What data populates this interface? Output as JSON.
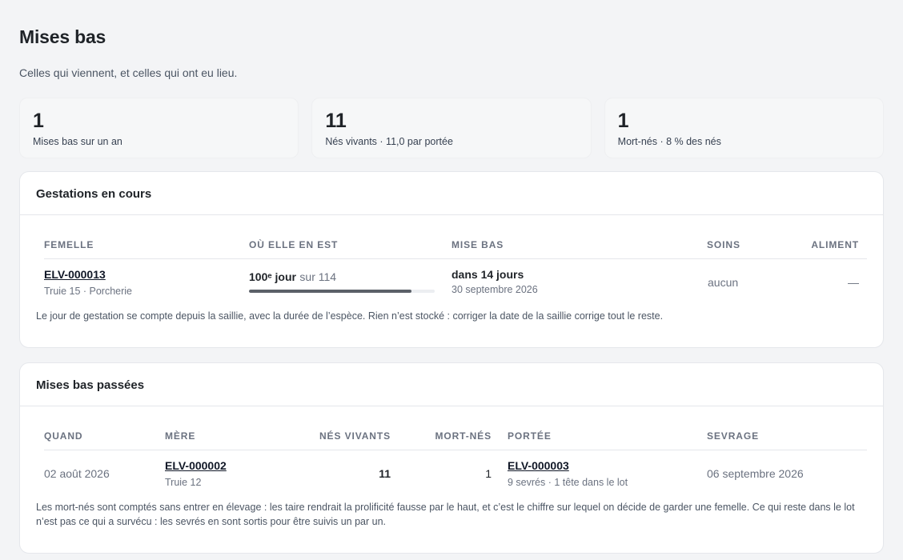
{
  "page": {
    "title": "Mises bas",
    "subtitle": "Celles qui viennent, et celles qui ont eu lieu."
  },
  "stats": [
    {
      "value": "1",
      "label": "Mises bas sur un an"
    },
    {
      "value": "11",
      "label": "Nés vivants · 11,0 par portée"
    },
    {
      "value": "1",
      "label": "Mort-nés · 8 % des nés"
    }
  ],
  "gestations": {
    "title": "Gestations en cours",
    "columns": {
      "femelle": "Femelle",
      "progress": "Où elle en est",
      "mise_bas": "Mise bas",
      "soins": "Soins",
      "aliment": "Aliment"
    },
    "row": {
      "id": "ELV-000013",
      "location": "Truie 15 · Porcherie",
      "day": "100ᵉ jour",
      "of": "sur 114",
      "progress": 0.877,
      "due_in": "dans 14 jours",
      "due_date": "30 septembre 2026",
      "soins": "aucun",
      "aliment": "—"
    },
    "note": "Le jour de gestation se compte depuis la saillie, avec la durée de l’espèce. Rien n’est stocké : corriger la date de la saillie corrige tout le reste."
  },
  "passees": {
    "title": "Mises bas passées",
    "columns": {
      "quand": "Quand",
      "mere": "Mère",
      "vivants": "Nés vivants",
      "mortnes": "Mort-nés",
      "portee": "Portée",
      "sevrage": "Sevrage"
    },
    "row": {
      "date": "02 août 2026",
      "mere_id": "ELV-000002",
      "mere_sub": "Truie 12",
      "vivants": "11",
      "mortnes": "1",
      "portee_id": "ELV-000003",
      "portee_sub": "9 sevrés · 1 tête dans le lot",
      "sevrage": "06 septembre 2026"
    },
    "note": "Les mort-nés sont comptés sans entrer en élevage : les taire rendrait la prolificité fausse par le haut, et c’est le chiffre sur lequel on décide de garder une femelle. Ce qui reste dans le lot n’est pas ce qui a survécu : les sevrés en sont sortis pour être suivis un par un."
  }
}
